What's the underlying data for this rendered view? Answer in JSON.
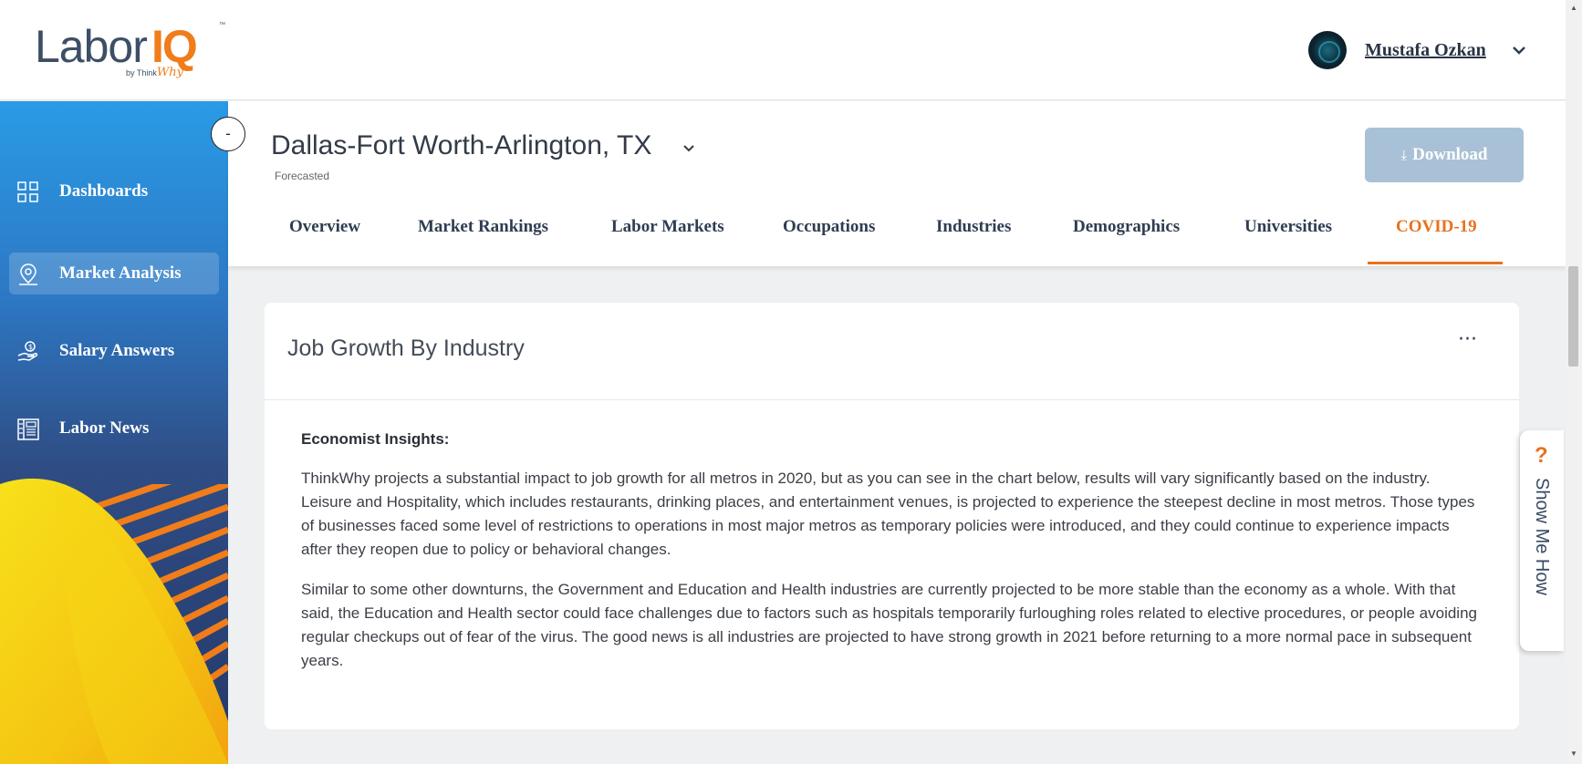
{
  "brand": {
    "logo_labor": "Labor",
    "logo_iq": "IQ",
    "logo_by": "by Think",
    "logo_why": "Why",
    "logo_tm": "™",
    "accent_color": "#e8721c"
  },
  "user": {
    "name": "Mustafa Ozkan",
    "avatar_icon": "fingerprint-avatar"
  },
  "sidebar": {
    "collapse_label": "-",
    "items": [
      {
        "label": "Dashboards",
        "icon": "grid-icon",
        "active": false
      },
      {
        "label": "Market Analysis",
        "icon": "map-pin-icon",
        "active": true
      },
      {
        "label": "Salary Answers",
        "icon": "salary-hand-icon",
        "active": false
      },
      {
        "label": "Labor News",
        "icon": "newspaper-icon",
        "active": false
      }
    ]
  },
  "location": {
    "title": "Dallas-Fort Worth-Arlington, TX",
    "subtitle": "Forecasted"
  },
  "download": {
    "label": "Download"
  },
  "tabs": [
    {
      "label": "Overview",
      "active": false
    },
    {
      "label": "Market Rankings",
      "active": false
    },
    {
      "label": "Labor Markets",
      "active": false
    },
    {
      "label": "Occupations",
      "active": false
    },
    {
      "label": "Industries",
      "active": false
    },
    {
      "label": "Demographics",
      "active": false
    },
    {
      "label": "Universities",
      "active": false
    },
    {
      "label": "COVID-19",
      "active": true
    }
  ],
  "card": {
    "title": "Job Growth By Industry",
    "more_label": "···",
    "insights_label": "Economist Insights:",
    "paragraphs": [
      "ThinkWhy projects a substantial impact to job growth for all metros in 2020, but as you can see in the chart below, results will vary significantly based on the industry. Leisure and Hospitality, which includes restaurants, drinking places, and entertainment venues, is projected to experience the steepest decline in most metros. Those types of businesses faced some level of restrictions to operations in most major metros as temporary policies were introduced, and they could continue to experience impacts after they reopen due to policy or behavioral changes.",
      "Similar to some other downturns, the Government and Education and Health industries are currently projected to be more stable than the economy as a whole. With that said, the Education and Health sector could face challenges due to factors such as hospitals temporarily furloughing roles related to elective procedures, or people avoiding regular checkups out of fear of the virus. The good news is all industries are projected to have strong growth in 2021 before returning to a more normal pace in subsequent years."
    ]
  },
  "help": {
    "question_mark": "?",
    "label": "Show Me How"
  }
}
